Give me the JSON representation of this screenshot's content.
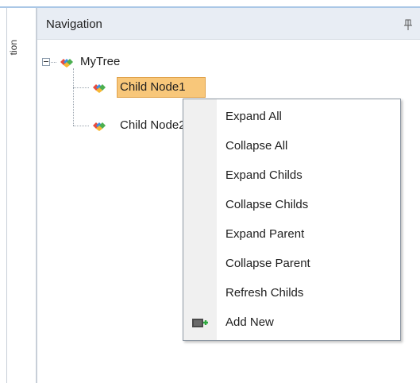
{
  "side_strip": {
    "label": "tion"
  },
  "pane": {
    "title": "Navigation"
  },
  "tree": {
    "root": {
      "label": "MyTree"
    },
    "children": [
      {
        "label": "Child Node1",
        "selected": true
      },
      {
        "label": "Child Node2"
      }
    ]
  },
  "context_menu": {
    "items": [
      {
        "label": "Expand All"
      },
      {
        "label": "Collapse All"
      },
      {
        "label": "Expand Childs"
      },
      {
        "label": "Collapse Childs"
      },
      {
        "label": "Expand Parent"
      },
      {
        "label": "Collapse Parent"
      },
      {
        "label": "Refresh Childs"
      },
      {
        "label": "Add New",
        "icon": "add-new-icon"
      }
    ]
  },
  "colors": {
    "header_bg": "#e8edf4",
    "selection_bg": "#f8c77a",
    "selection_border": "#e0a24a",
    "menu_gutter": "#f0f0f0"
  }
}
